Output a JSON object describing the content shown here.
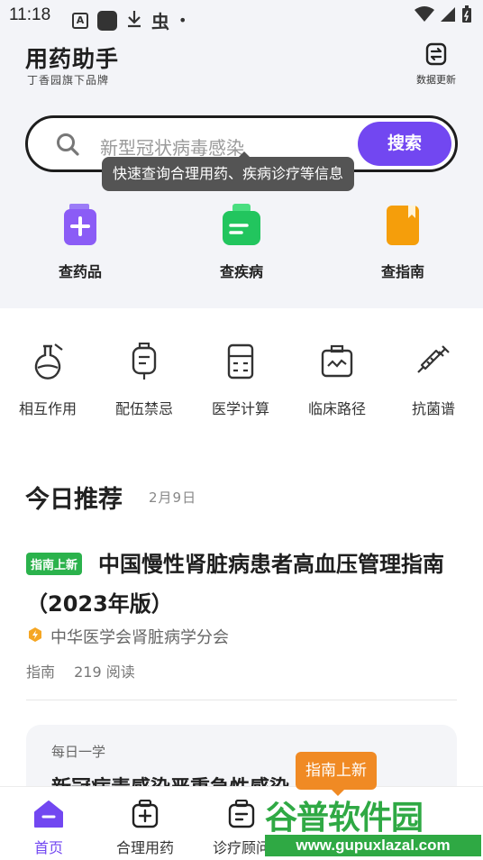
{
  "status_bar": {
    "time": "11:18",
    "a_badge": "A",
    "bug": "虫",
    "dot": "•"
  },
  "header": {
    "app_title": "用药助手",
    "subtitle": "丁香园旗下品牌",
    "data_update_label": "数据更新"
  },
  "search": {
    "placeholder": "新型冠状病毒感染",
    "button_label": "搜索",
    "tooltip": "快速查询合理用药、疾病诊疗等信息",
    "accent_color": "#7247f1"
  },
  "quick_entries": [
    {
      "label": "查药品",
      "icon": "drug-bottle-icon",
      "color": "#8b5cf6"
    },
    {
      "label": "查疾病",
      "icon": "medical-kit-icon",
      "color": "#22c55e"
    },
    {
      "label": "查指南",
      "icon": "guide-book-icon",
      "color": "#f59e0b"
    }
  ],
  "tools": [
    {
      "label": "相互作用",
      "icon": "flask-icon"
    },
    {
      "label": "配伍禁忌",
      "icon": "iv-bag-icon"
    },
    {
      "label": "医学计算",
      "icon": "calculator-icon"
    },
    {
      "label": "临床路径",
      "icon": "clinical-case-icon"
    },
    {
      "label": "抗菌谱",
      "icon": "syringe-icon"
    }
  ],
  "recommend": {
    "title": "今日推荐",
    "date": "2月9日"
  },
  "article": {
    "badge": "指南上新",
    "badge_color": "#2bb24c",
    "title": "中国慢性肾脏病患者高血压管理指南（2023年版）",
    "source": "中华医学会肾脏病学分会",
    "category": "指南",
    "reads": "219 阅读"
  },
  "daily": {
    "label": "每日一学",
    "text": "新冠病毒感染严重急性感染"
  },
  "floating_tag": {
    "label": "指南上新",
    "color": "#f08a24"
  },
  "bottom_nav": [
    {
      "label": "首页",
      "icon": "home-icon",
      "active": true
    },
    {
      "label": "合理用药",
      "icon": "medicine-bag-icon",
      "active": false
    },
    {
      "label": "诊疗顾问",
      "icon": "consult-icon",
      "active": false
    }
  ],
  "watermark": {
    "brand": "谷普软件园",
    "url": "www.gupuxlazal.com"
  }
}
